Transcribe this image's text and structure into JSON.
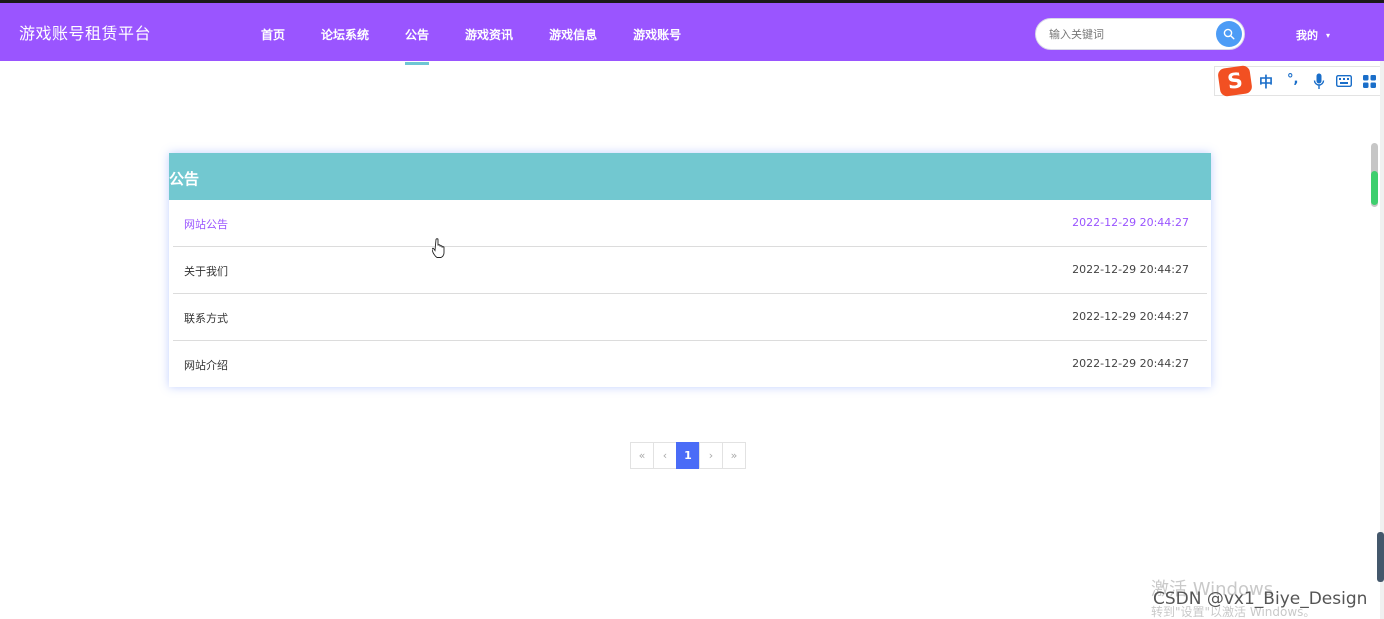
{
  "header": {
    "brand": "游戏账号租赁平台",
    "nav": [
      "首页",
      "论坛系统",
      "公告",
      "游戏资讯",
      "游戏信息",
      "游戏账号"
    ],
    "active_nav_index": 2,
    "search_placeholder": "输入关键词",
    "mine_label": "我的"
  },
  "ime_toolbar": {
    "logo": "S",
    "items": [
      "中",
      "°,"
    ]
  },
  "notice_panel": {
    "title": "公告",
    "rows": [
      {
        "title": "网站公告",
        "time": "2022-12-29 20:44:27",
        "highlighted": true
      },
      {
        "title": "关于我们",
        "time": "2022-12-29 20:44:27",
        "highlighted": false
      },
      {
        "title": "联系方式",
        "time": "2022-12-29 20:44:27",
        "highlighted": false
      },
      {
        "title": "网站介绍",
        "time": "2022-12-29 20:44:27",
        "highlighted": false
      }
    ]
  },
  "pagination": {
    "first": "«",
    "prev": "‹",
    "current": "1",
    "next": "›",
    "last": "»"
  },
  "overlay": {
    "windows_activate": "激活 Windows",
    "windows_activate_hint": "转到\"设置\"以激活 Windows。",
    "csdn_watermark": "CSDN @vx1_Biye_Design"
  },
  "colors": {
    "header_bg": "#9a55ff",
    "panel_head_bg": "#72c8d0",
    "highlight_text": "#9a55ff",
    "page_current_bg": "#4a6cf7",
    "search_button": "#4d9cf6"
  }
}
